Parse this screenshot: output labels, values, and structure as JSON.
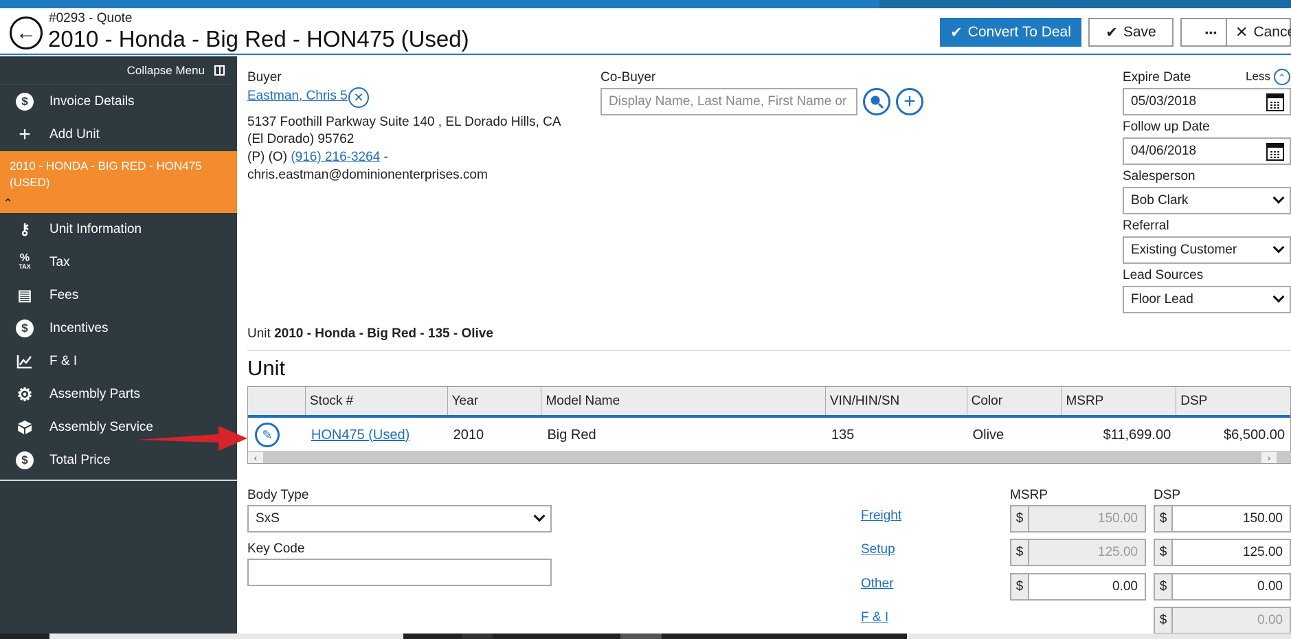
{
  "header": {
    "subtitle": "#0293 - Quote",
    "title": "2010 - Honda - Big Red - HON475 (Used)",
    "back_icon": "back-arrow-icon",
    "buttons": {
      "convert": "Convert To Deal",
      "save": "Save",
      "more": "▪▪▪",
      "cancel": "Cance"
    }
  },
  "sidebar": {
    "collapse_label": "Collapse Menu",
    "items_top": [
      {
        "label": "Invoice Details",
        "icon": "dollar-circle-icon"
      },
      {
        "label": "Add Unit",
        "icon": "plus-icon"
      }
    ],
    "active_item": "2010 - HONDA - BIG RED - HON475 (USED)",
    "items_bottom": [
      {
        "label": "Unit Information",
        "icon": "key-icon"
      },
      {
        "label": "Tax",
        "icon": "percent-tax-icon"
      },
      {
        "label": "Fees",
        "icon": "document-icon"
      },
      {
        "label": "Incentives",
        "icon": "dollar-circle-icon"
      },
      {
        "label": "F & I",
        "icon": "chart-line-icon"
      },
      {
        "label": "Assembly Parts",
        "icon": "gear-icon"
      },
      {
        "label": "Assembly Service",
        "icon": "box-icon"
      },
      {
        "label": "Total Price",
        "icon": "dollar-circle-icon"
      }
    ]
  },
  "buyer": {
    "label": "Buyer",
    "name": "Eastman, Chris 5",
    "address_line1": "5137 Foothill Parkway Suite 140 , EL Dorado Hills, CA",
    "address_line2": "(El Dorado) 95762",
    "phone_prefix": "(P) (O)",
    "phone": "(916) 216-3264",
    "phone_suffix": "-",
    "email": "chris.eastman@dominionenterprises.com"
  },
  "cobuyer": {
    "label": "Co-Buyer",
    "placeholder": "Display Name, Last Name, First Name or"
  },
  "right_panel": {
    "less_label": "Less",
    "expire_label": "Expire Date",
    "expire_value": "05/03/2018",
    "followup_label": "Follow up Date",
    "followup_value": "04/06/2018",
    "salesperson_label": "Salesperson",
    "salesperson_value": "Bob Clark",
    "referral_label": "Referral",
    "referral_value": "Existing Customer",
    "lead_label": "Lead Sources",
    "lead_value": "Floor Lead"
  },
  "unit_summary": {
    "prefix": "Unit",
    "bold": "2010 - Honda - Big Red - 135 - Olive"
  },
  "unit_heading": "Unit",
  "grid": {
    "columns": [
      "",
      "Stock #",
      "Year",
      "Model Name",
      "VIN/HIN/SN",
      "Color",
      "MSRP",
      "DSP"
    ],
    "row": {
      "stock": "HON475 (Used)",
      "year": "2010",
      "model": "Big Red",
      "vin": "135",
      "color": "Olive",
      "msrp": "$11,699.00",
      "dsp": "$6,500.00"
    }
  },
  "details": {
    "body_type_label": "Body Type",
    "body_type_value": "SxS",
    "key_code_label": "Key Code",
    "key_code_value": "",
    "msrp_label": "MSRP",
    "dsp_label": "DSP",
    "dollar": "$",
    "fees": [
      {
        "label": "Freight",
        "msrp": "150.00",
        "dsp": "150.00"
      },
      {
        "label": "Setup",
        "msrp": "125.00",
        "dsp": "125.00"
      },
      {
        "label": "Other",
        "msrp": "0.00",
        "dsp": "0.00"
      },
      {
        "label": "F & I",
        "msrp": "",
        "dsp": "0.00"
      }
    ]
  },
  "colors": {
    "accent": "#1f7bc1",
    "sidebar": "#2f3a40",
    "active": "#f28c2e",
    "link": "#1f6fbf",
    "arrow": "#d9232a"
  }
}
